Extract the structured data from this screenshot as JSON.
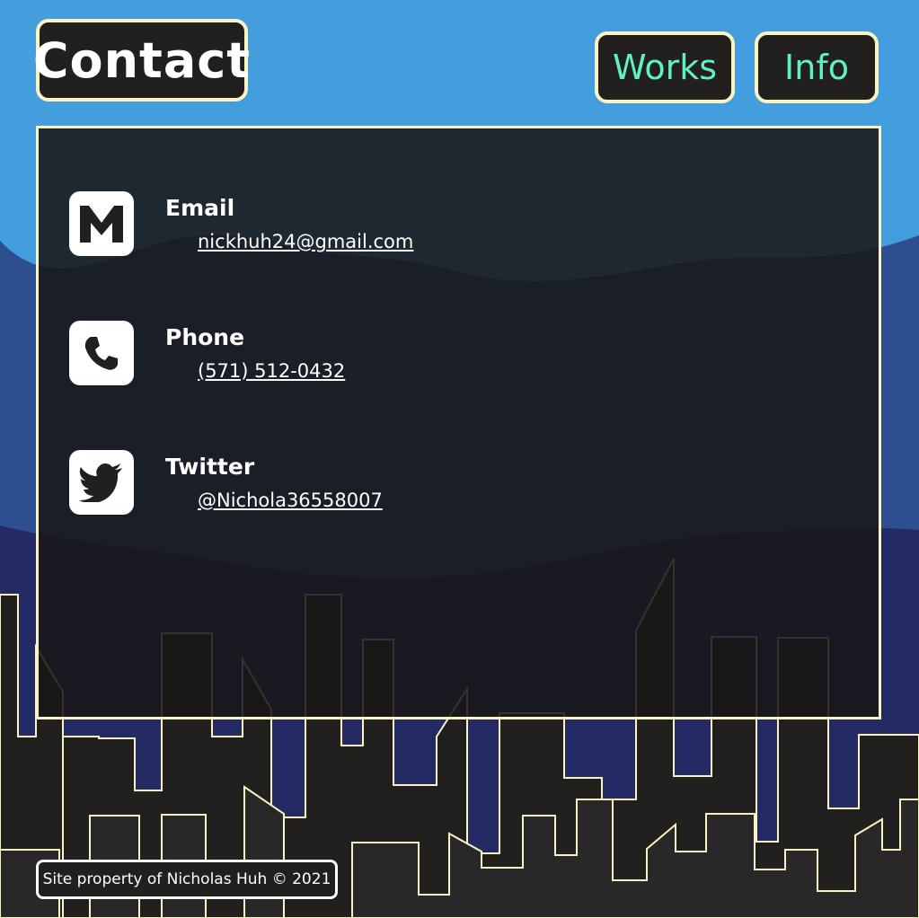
{
  "header": {
    "title": "Contact",
    "nav": [
      {
        "label": "Works"
      },
      {
        "label": "Info"
      }
    ]
  },
  "contacts": [
    {
      "label": "Email",
      "value": "nickhuh24@gmail.com",
      "icon": "gmail-m-icon"
    },
    {
      "label": "Phone",
      "value": "(571) 512-0432",
      "icon": "phone-icon"
    },
    {
      "label": "Twitter",
      "value": "@Nichola36558007",
      "icon": "twitter-bird-icon"
    }
  ],
  "footer": {
    "text": "Site property of Nicholas Huh © 2021"
  },
  "colors": {
    "sky": "#449ddc",
    "mountain_far": "#2d4f8f",
    "mountain_near": "#242a63",
    "building": "#221f1f",
    "outline": "#fbf3c4",
    "nav_text": "#5ff2c0",
    "panel": "#181818"
  }
}
